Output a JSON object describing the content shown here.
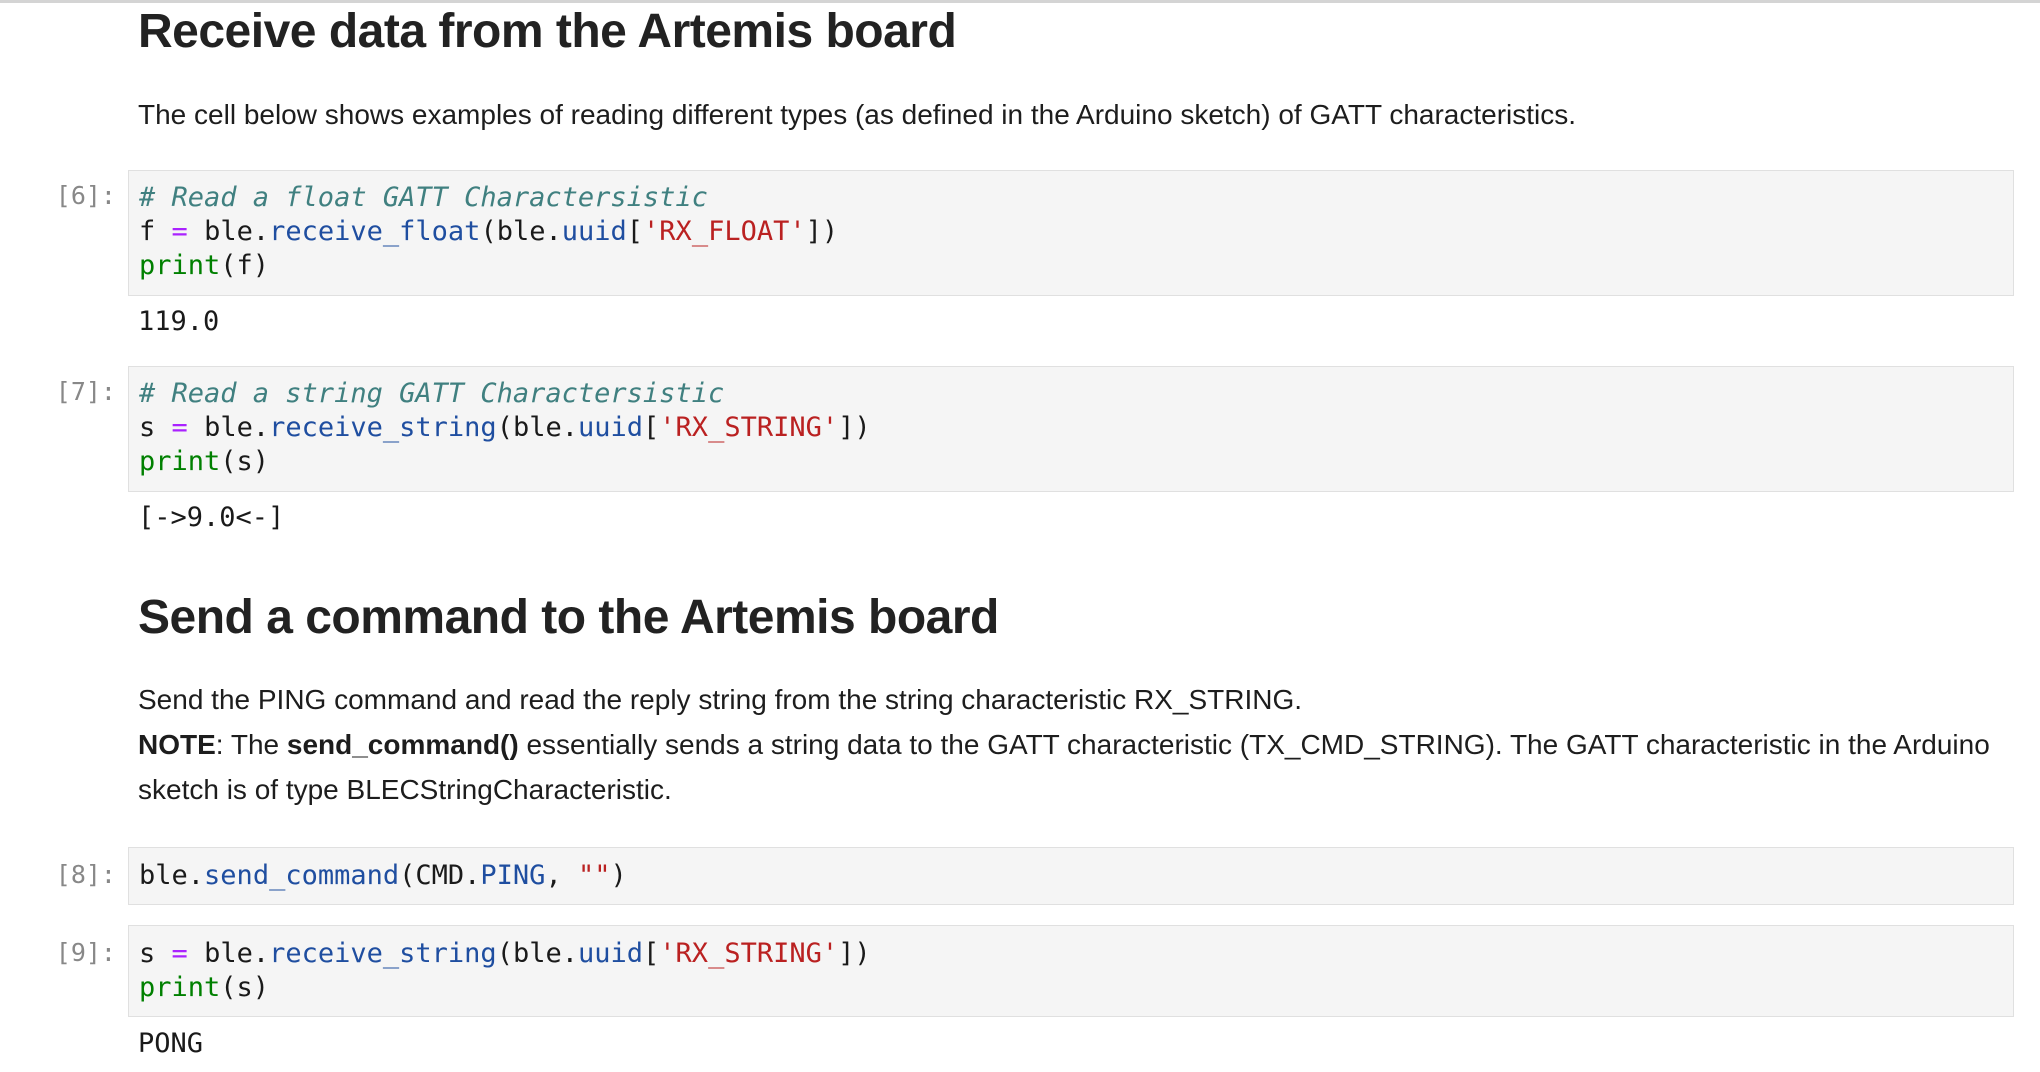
{
  "section1": {
    "heading": "Receive data from the Artemis board",
    "description": "The cell below shows examples of reading different types (as defined in the Arduino sketch) of GATT characteristics."
  },
  "cells": [
    {
      "prompt": "[6]:",
      "comment": "# Read a float GATT Charactersistic",
      "line2": {
        "var": "f",
        "op": "=",
        "obj": "ble",
        "dot": ".",
        "func": "receive_float",
        "open": "(",
        "arg_obj": "ble",
        "arg_dot": ".",
        "arg_attr": "uuid",
        "lbr": "[",
        "key": "'RX_FLOAT'",
        "rbr": "])"
      },
      "line3": {
        "builtin": "print",
        "args": "(f)"
      },
      "output": "119.0"
    },
    {
      "prompt": "[7]:",
      "comment": "# Read a string GATT Charactersistic",
      "line2": {
        "var": "s",
        "op": "=",
        "obj": "ble",
        "dot": ".",
        "func": "receive_string",
        "open": "(",
        "arg_obj": "ble",
        "arg_dot": ".",
        "arg_attr": "uuid",
        "lbr": "[",
        "key": "'RX_STRING'",
        "rbr": "])"
      },
      "line3": {
        "builtin": "print",
        "args": "(s)"
      },
      "output": "[->9.0<-]"
    },
    {
      "prompt": "[8]:",
      "line1": {
        "obj": "ble",
        "dot": ".",
        "func": "send_command",
        "open": "(CMD.",
        "attr": "PING",
        "comma": ", ",
        "str": "\"\"",
        "close": ")"
      }
    },
    {
      "prompt": "[9]:",
      "line1": {
        "var": "s",
        "op": "=",
        "obj": "ble",
        "dot": ".",
        "func": "receive_string",
        "open": "(",
        "arg_obj": "ble",
        "arg_dot": ".",
        "arg_attr": "uuid",
        "lbr": "[",
        "key": "'RX_STRING'",
        "rbr": "])"
      },
      "line2": {
        "builtin": "print",
        "args": "(s)"
      },
      "output": "PONG"
    }
  ],
  "section2": {
    "heading": "Send a command to the Artemis board",
    "line1": "Send the PING command and read the reply string from the string characteristic RX_STRING.",
    "note_label": "NOTE",
    "note_a": ": The ",
    "note_func": "send_command()",
    "note_b": " essentially sends a string data to the GATT characteristic (TX_CMD_STRING). The GATT characteristic in the Arduino sketch is of type BLECStringCharacteristic."
  }
}
